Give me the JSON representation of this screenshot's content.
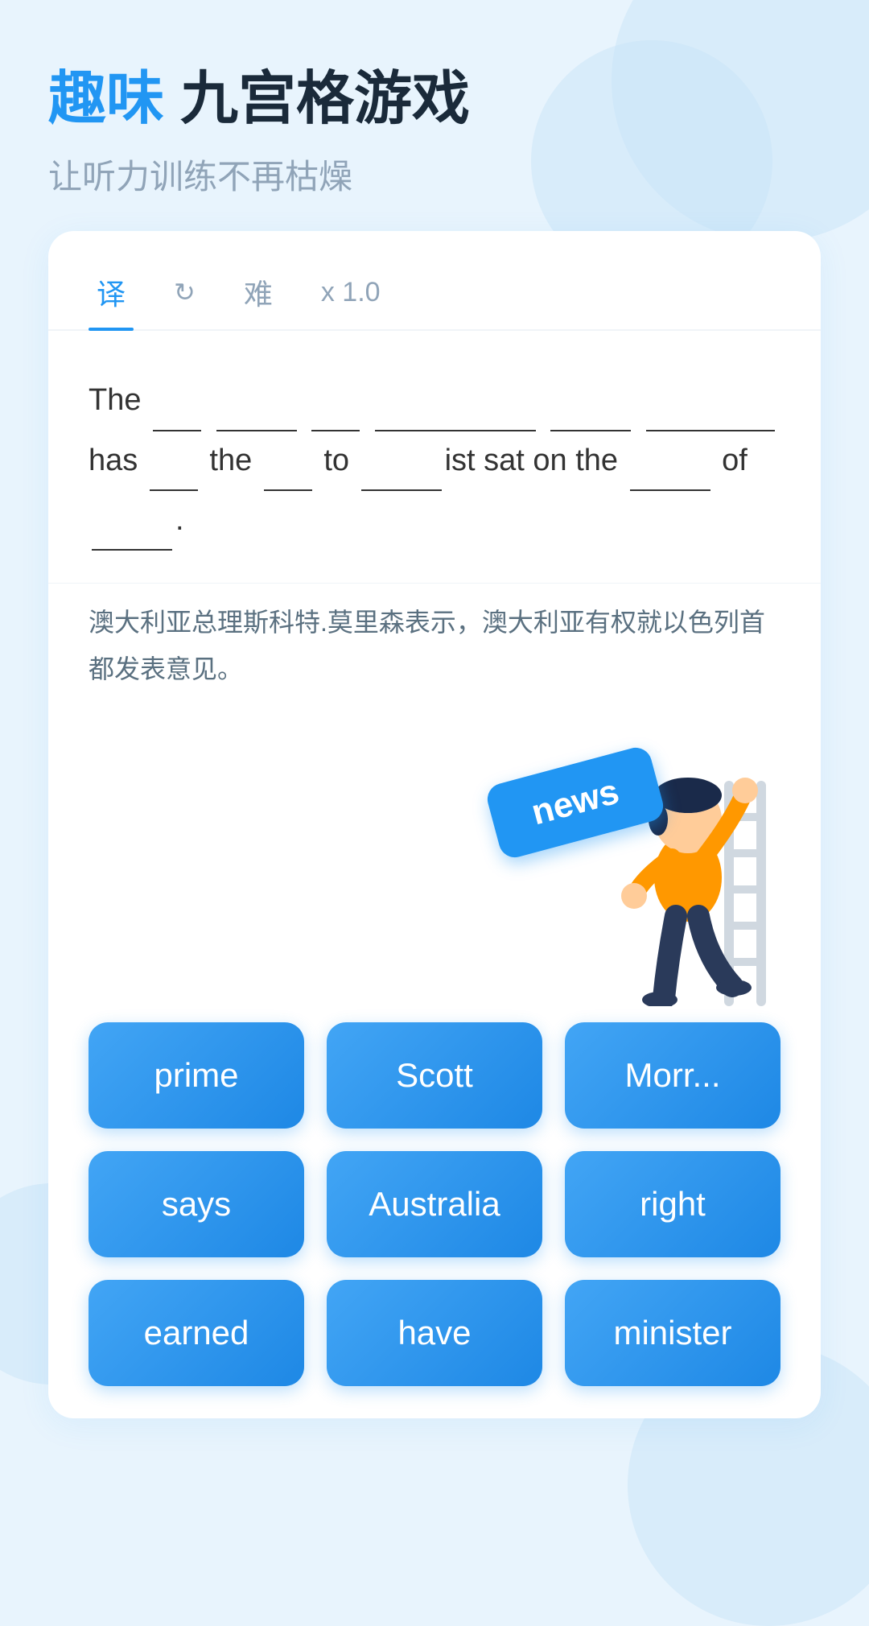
{
  "header": {
    "title_highlight": "趣味",
    "title_rest": " 九宫格游戏",
    "subtitle": "让听力训练不再枯燥"
  },
  "tabs": [
    {
      "id": "translate",
      "label": "译",
      "active": true
    },
    {
      "id": "refresh",
      "label": "↻",
      "active": false
    },
    {
      "id": "hard",
      "label": "难",
      "active": false
    },
    {
      "id": "speed",
      "label": "x 1.0",
      "active": false
    }
  ],
  "sentence": {
    "text": "The ___ ______ ___ __________ _____ ________has ___ the ___ to _____ist sat on the _____ of _____.",
    "translation": "澳大利亚总理斯科特.莫里森表示，澳大利亚有权就以色列首都发表意见。"
  },
  "news_chip": "news",
  "word_buttons": [
    {
      "id": "prime",
      "label": "prime"
    },
    {
      "id": "scott",
      "label": "Scott"
    },
    {
      "id": "morrison",
      "label": "Morr..."
    },
    {
      "id": "says",
      "label": "says"
    },
    {
      "id": "australia",
      "label": "Australia"
    },
    {
      "id": "right",
      "label": "right"
    },
    {
      "id": "earned",
      "label": "earned"
    },
    {
      "id": "have",
      "label": "have"
    },
    {
      "id": "minister",
      "label": "minister"
    }
  ],
  "colors": {
    "accent": "#2196F3",
    "bg": "#e8f4fd",
    "card": "#ffffff",
    "text_dark": "#1a2a3a",
    "text_gray": "#90a4b8"
  }
}
